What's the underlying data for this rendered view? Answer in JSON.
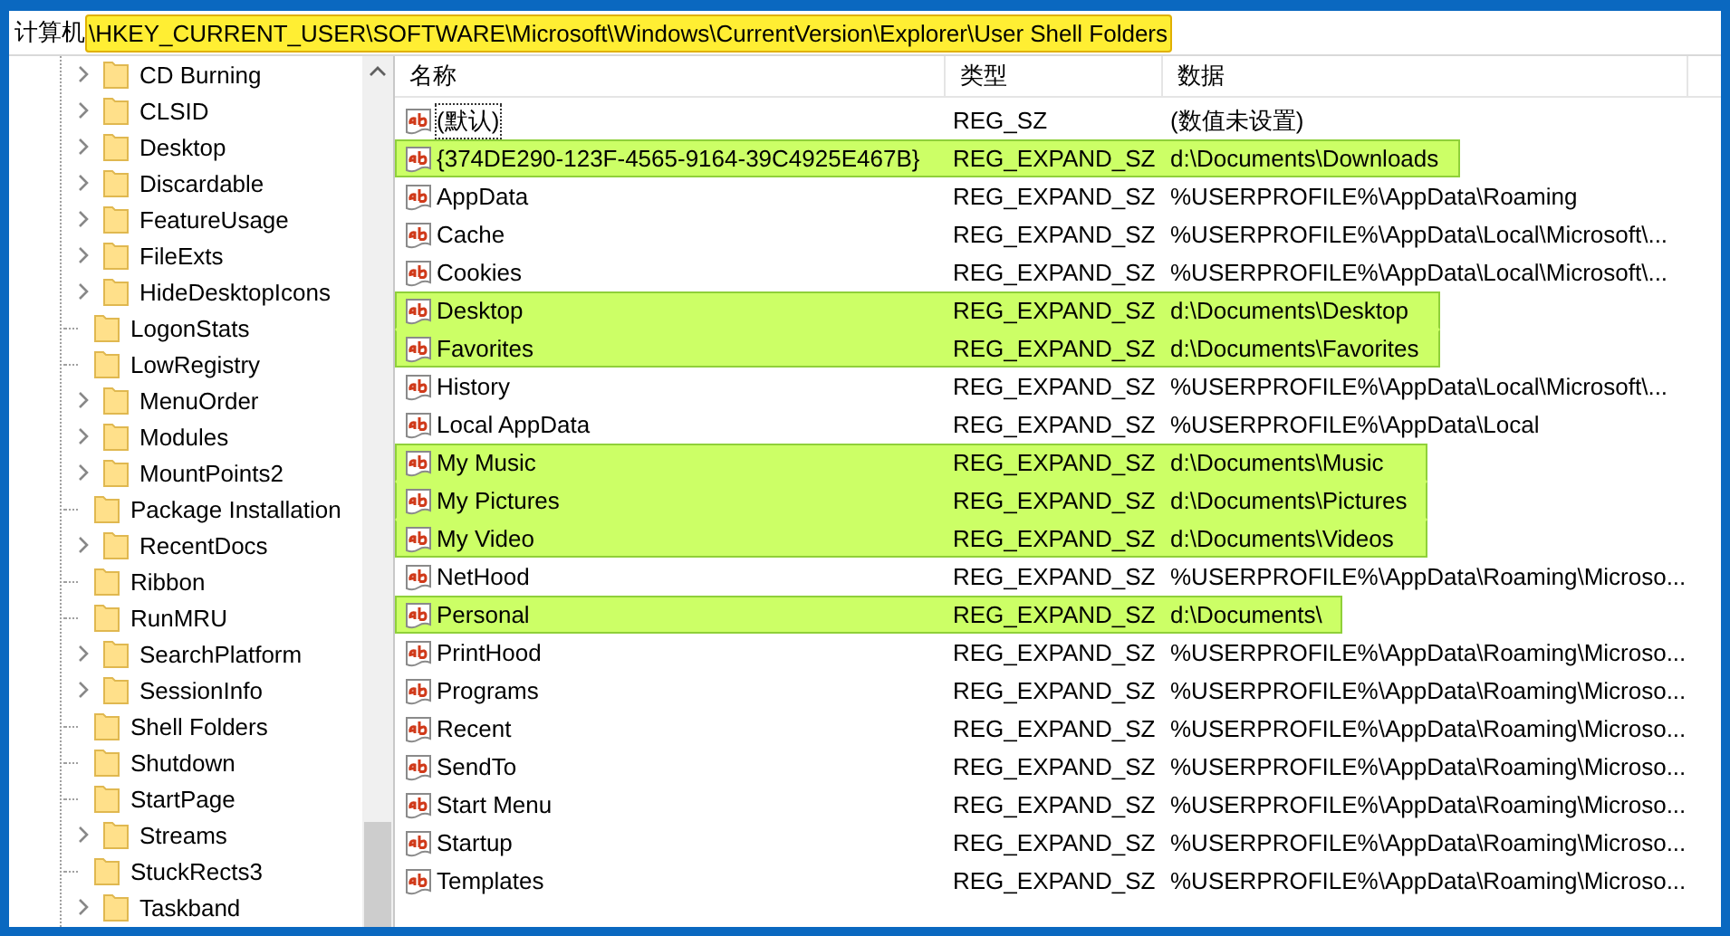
{
  "address": {
    "prefix": "计算机",
    "path": "\\HKEY_CURRENT_USER\\SOFTWARE\\Microsoft\\Windows\\CurrentVersion\\Explorer\\User Shell Folders",
    "path_highlighted": true
  },
  "tree": [
    {
      "label": "CD Burning",
      "expandable": true
    },
    {
      "label": "CLSID",
      "expandable": true
    },
    {
      "label": "Desktop",
      "expandable": true
    },
    {
      "label": "Discardable",
      "expandable": true
    },
    {
      "label": "FeatureUsage",
      "expandable": true
    },
    {
      "label": "FileExts",
      "expandable": true
    },
    {
      "label": "HideDesktopIcons",
      "expandable": true
    },
    {
      "label": "LogonStats",
      "expandable": false
    },
    {
      "label": "LowRegistry",
      "expandable": false
    },
    {
      "label": "MenuOrder",
      "expandable": true
    },
    {
      "label": "Modules",
      "expandable": true
    },
    {
      "label": "MountPoints2",
      "expandable": true
    },
    {
      "label": "Package Installation",
      "expandable": false
    },
    {
      "label": "RecentDocs",
      "expandable": true
    },
    {
      "label": "Ribbon",
      "expandable": false
    },
    {
      "label": "RunMRU",
      "expandable": false
    },
    {
      "label": "SearchPlatform",
      "expandable": true
    },
    {
      "label": "SessionInfo",
      "expandable": true
    },
    {
      "label": "Shell Folders",
      "expandable": false
    },
    {
      "label": "Shutdown",
      "expandable": false
    },
    {
      "label": "StartPage",
      "expandable": false
    },
    {
      "label": "Streams",
      "expandable": true
    },
    {
      "label": "StuckRects3",
      "expandable": false
    },
    {
      "label": "Taskband",
      "expandable": true
    }
  ],
  "table": {
    "columns": [
      "名称",
      "类型",
      "数据"
    ],
    "rows": [
      {
        "name": "(默认)",
        "type": "REG_SZ",
        "data": "(数值未设置)",
        "focused": true,
        "highlighted": false
      },
      {
        "name": "{374DE290-123F-4565-9164-39C4925E467B}",
        "type": "REG_EXPAND_SZ",
        "data": "d:\\Documents\\Downloads",
        "focused": false,
        "highlighted": true
      },
      {
        "name": "AppData",
        "type": "REG_EXPAND_SZ",
        "data": "%USERPROFILE%\\AppData\\Roaming",
        "focused": false,
        "highlighted": false
      },
      {
        "name": "Cache",
        "type": "REG_EXPAND_SZ",
        "data": "%USERPROFILE%\\AppData\\Local\\Microsoft\\...",
        "focused": false,
        "highlighted": false
      },
      {
        "name": "Cookies",
        "type": "REG_EXPAND_SZ",
        "data": "%USERPROFILE%\\AppData\\Local\\Microsoft\\...",
        "focused": false,
        "highlighted": false
      },
      {
        "name": "Desktop",
        "type": "REG_EXPAND_SZ",
        "data": "d:\\Documents\\Desktop",
        "focused": false,
        "highlighted": true
      },
      {
        "name": "Favorites",
        "type": "REG_EXPAND_SZ",
        "data": "d:\\Documents\\Favorites",
        "focused": false,
        "highlighted": true
      },
      {
        "name": "History",
        "type": "REG_EXPAND_SZ",
        "data": "%USERPROFILE%\\AppData\\Local\\Microsoft\\...",
        "focused": false,
        "highlighted": false
      },
      {
        "name": "Local AppData",
        "type": "REG_EXPAND_SZ",
        "data": "%USERPROFILE%\\AppData\\Local",
        "focused": false,
        "highlighted": false
      },
      {
        "name": "My Music",
        "type": "REG_EXPAND_SZ",
        "data": "d:\\Documents\\Music",
        "focused": false,
        "highlighted": true
      },
      {
        "name": "My Pictures",
        "type": "REG_EXPAND_SZ",
        "data": "d:\\Documents\\Pictures",
        "focused": false,
        "highlighted": true
      },
      {
        "name": "My Video",
        "type": "REG_EXPAND_SZ",
        "data": "d:\\Documents\\Videos",
        "focused": false,
        "highlighted": true
      },
      {
        "name": "NetHood",
        "type": "REG_EXPAND_SZ",
        "data": "%USERPROFILE%\\AppData\\Roaming\\Microso...",
        "focused": false,
        "highlighted": false
      },
      {
        "name": "Personal",
        "type": "REG_EXPAND_SZ",
        "data": "d:\\Documents\\",
        "focused": false,
        "highlighted": true
      },
      {
        "name": "PrintHood",
        "type": "REG_EXPAND_SZ",
        "data": "%USERPROFILE%\\AppData\\Roaming\\Microso...",
        "focused": false,
        "highlighted": false
      },
      {
        "name": "Programs",
        "type": "REG_EXPAND_SZ",
        "data": "%USERPROFILE%\\AppData\\Roaming\\Microso...",
        "focused": false,
        "highlighted": false
      },
      {
        "name": "Recent",
        "type": "REG_EXPAND_SZ",
        "data": "%USERPROFILE%\\AppData\\Roaming\\Microso...",
        "focused": false,
        "highlighted": false
      },
      {
        "name": "SendTo",
        "type": "REG_EXPAND_SZ",
        "data": "%USERPROFILE%\\AppData\\Roaming\\Microso...",
        "focused": false,
        "highlighted": false
      },
      {
        "name": "Start Menu",
        "type": "REG_EXPAND_SZ",
        "data": "%USERPROFILE%\\AppData\\Roaming\\Microso...",
        "focused": false,
        "highlighted": false
      },
      {
        "name": "Startup",
        "type": "REG_EXPAND_SZ",
        "data": "%USERPROFILE%\\AppData\\Roaming\\Microso...",
        "focused": false,
        "highlighted": false
      },
      {
        "name": "Templates",
        "type": "REG_EXPAND_SZ",
        "data": "%USERPROFILE%\\AppData\\Roaming\\Microso...",
        "focused": false,
        "highlighted": false
      }
    ]
  }
}
